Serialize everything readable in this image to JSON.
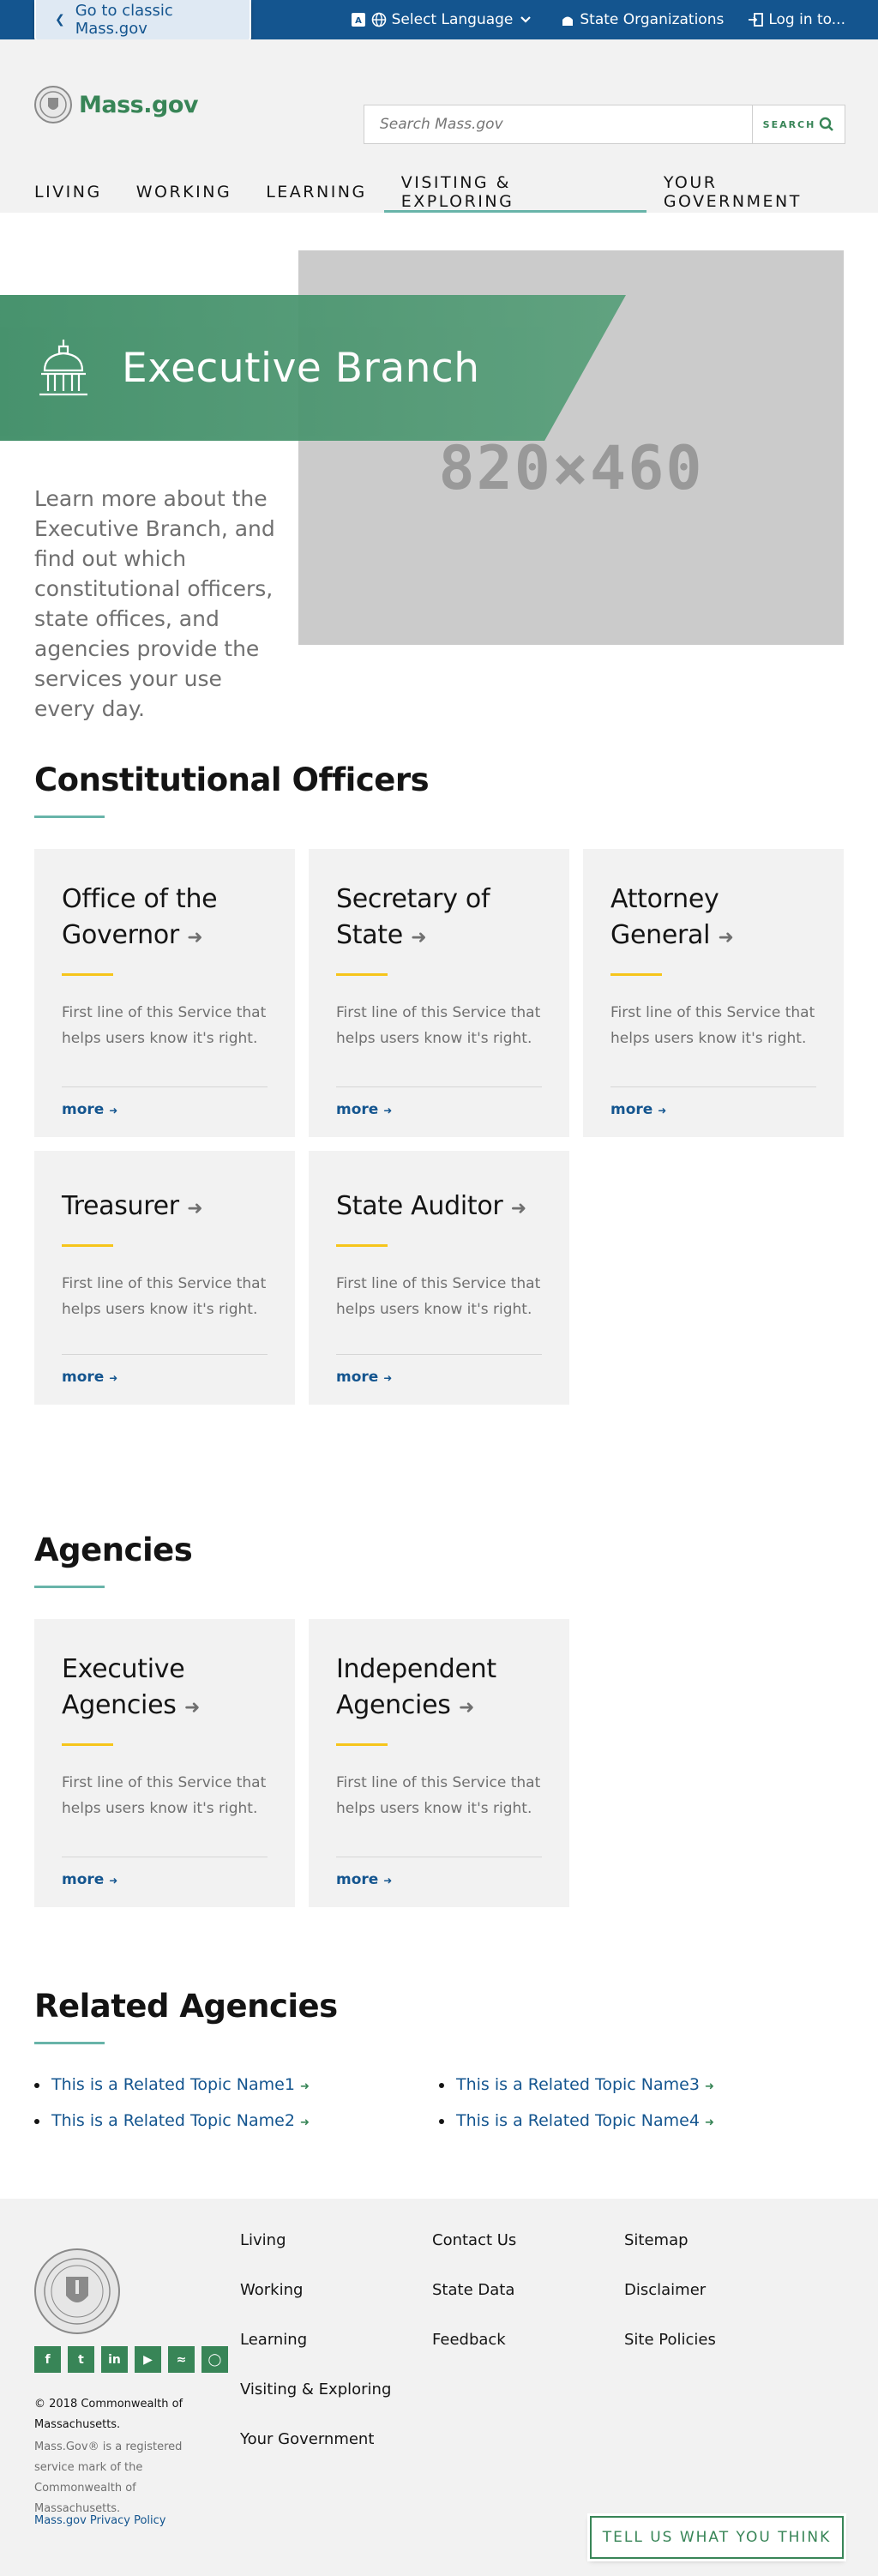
{
  "utility": {
    "classic_link": "Go to classic Mass.gov",
    "language": "Select Language",
    "state_orgs": "State Organizations",
    "login": "Log in to..."
  },
  "header": {
    "logo_text": "Mass.gov",
    "search_placeholder": "Search Mass.gov",
    "search_button": "SEARCH",
    "nav": [
      "LIVING",
      "WORKING",
      "LEARNING",
      "VISITING & EXPLORING",
      "YOUR GOVERNMENT"
    ]
  },
  "hero": {
    "title": "Executive Branch",
    "image_placeholder": "820×460",
    "lede": "Learn more about the Executive Branch, and find out which constitutional officers, state offices, and agencies provide the services your use every day."
  },
  "constitutional": {
    "title": "Constitutional Officers",
    "cards": [
      {
        "line1": "Office of the",
        "line2": "Governor",
        "desc": "First line of this Service that helps users know it's right.",
        "more": "more"
      },
      {
        "line1": "Secretary of",
        "line2": "State",
        "desc": "First line of this Service that helps users know it's right.",
        "more": "more"
      },
      {
        "line1": "Attorney",
        "line2": "General",
        "desc": "First line of this Service that helps users know it's right.",
        "more": "more"
      },
      {
        "line1": "",
        "line2": "Treasurer",
        "desc": "First line of this Service that helps users know it's right.",
        "more": "more"
      },
      {
        "line1": "",
        "line2": "State Auditor",
        "desc": "First line of this Service that helps users know it's right.",
        "more": "more"
      }
    ]
  },
  "agencies": {
    "title": "Agencies",
    "cards": [
      {
        "line1": "Executive",
        "line2": "Agencies",
        "desc": "First line of this Service that helps users know it's right.",
        "more": "more"
      },
      {
        "line1": "Independent",
        "line2": "Agencies",
        "desc": "First line of this Service that helps users know it's right.",
        "more": "more"
      }
    ]
  },
  "related": {
    "title": "Related Agencies",
    "items": [
      "This is a Related Topic Name1",
      "This is a Related Topic Name2",
      "This is a Related Topic Name3",
      "This is a Related Topic Name4"
    ]
  },
  "footer": {
    "copyright": "© 2018 Commonwealth of Massachusetts.",
    "trademark": "Mass.Gov® is a registered service mark of the Commonwealth of Massachusetts.",
    "privacy": "Mass.gov Privacy Policy",
    "col1": [
      "Living",
      "Working",
      "Learning",
      "Visiting & Exploring",
      "Your Government"
    ],
    "col2": [
      "Contact Us",
      "State Data",
      "Feedback"
    ],
    "col3": [
      "Sitemap",
      "Disclaimer",
      "Site Policies"
    ],
    "socials": [
      "facebook-icon",
      "twitter-icon",
      "linkedin-icon",
      "youtube-icon",
      "rss-icon",
      "instagram-icon"
    ],
    "feedback_button": "TELL US WHAT YOU THINK"
  },
  "colors": {
    "brand_blue": "#14558f",
    "brand_green": "#388557",
    "accent_teal": "#68b4a9",
    "accent_yellow": "#f6c51b"
  }
}
